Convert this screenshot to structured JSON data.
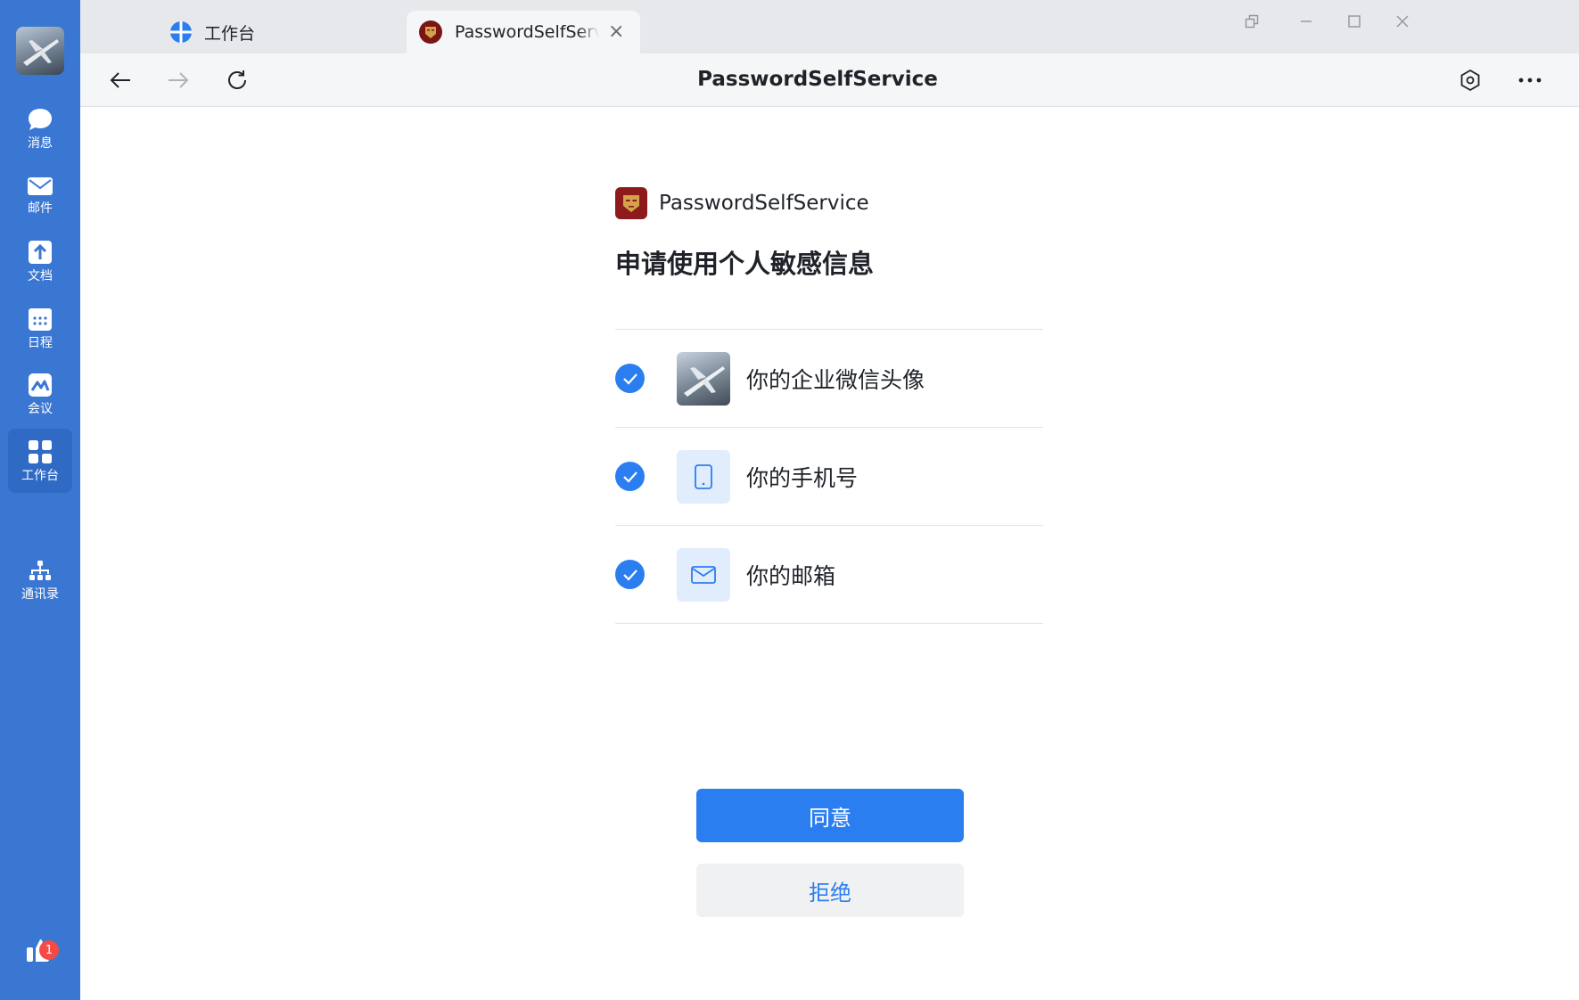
{
  "sidebar": {
    "items": [
      {
        "label": "消息",
        "icon": "message-icon"
      },
      {
        "label": "邮件",
        "icon": "mail-icon"
      },
      {
        "label": "文档",
        "icon": "document-icon"
      },
      {
        "label": "日程",
        "icon": "calendar-icon"
      },
      {
        "label": "会议",
        "icon": "meeting-icon"
      },
      {
        "label": "工作台",
        "icon": "workbench-icon",
        "active": true
      },
      {
        "label": "通讯录",
        "icon": "contacts-icon"
      }
    ],
    "badge_count": "1"
  },
  "tabs": [
    {
      "label": "工作台",
      "icon": "workbench-globe-icon"
    },
    {
      "label": "PasswordSelfService",
      "icon": "app-icon",
      "active": true
    }
  ],
  "navbar": {
    "title": "PasswordSelfService"
  },
  "content": {
    "app_name": "PasswordSelfService",
    "title": "申请使用个人敏感信息",
    "permissions": [
      {
        "label": "你的企业微信头像",
        "icon": "avatar-photo",
        "checked": true
      },
      {
        "label": "你的手机号",
        "icon": "phone-icon",
        "checked": true
      },
      {
        "label": "你的邮箱",
        "icon": "mail-icon",
        "checked": true
      }
    ],
    "agree_label": "同意",
    "reject_label": "拒绝"
  },
  "colors": {
    "sidebar": "#3a77d3",
    "accent": "#2b7ef0",
    "badge": "#f54a45"
  }
}
